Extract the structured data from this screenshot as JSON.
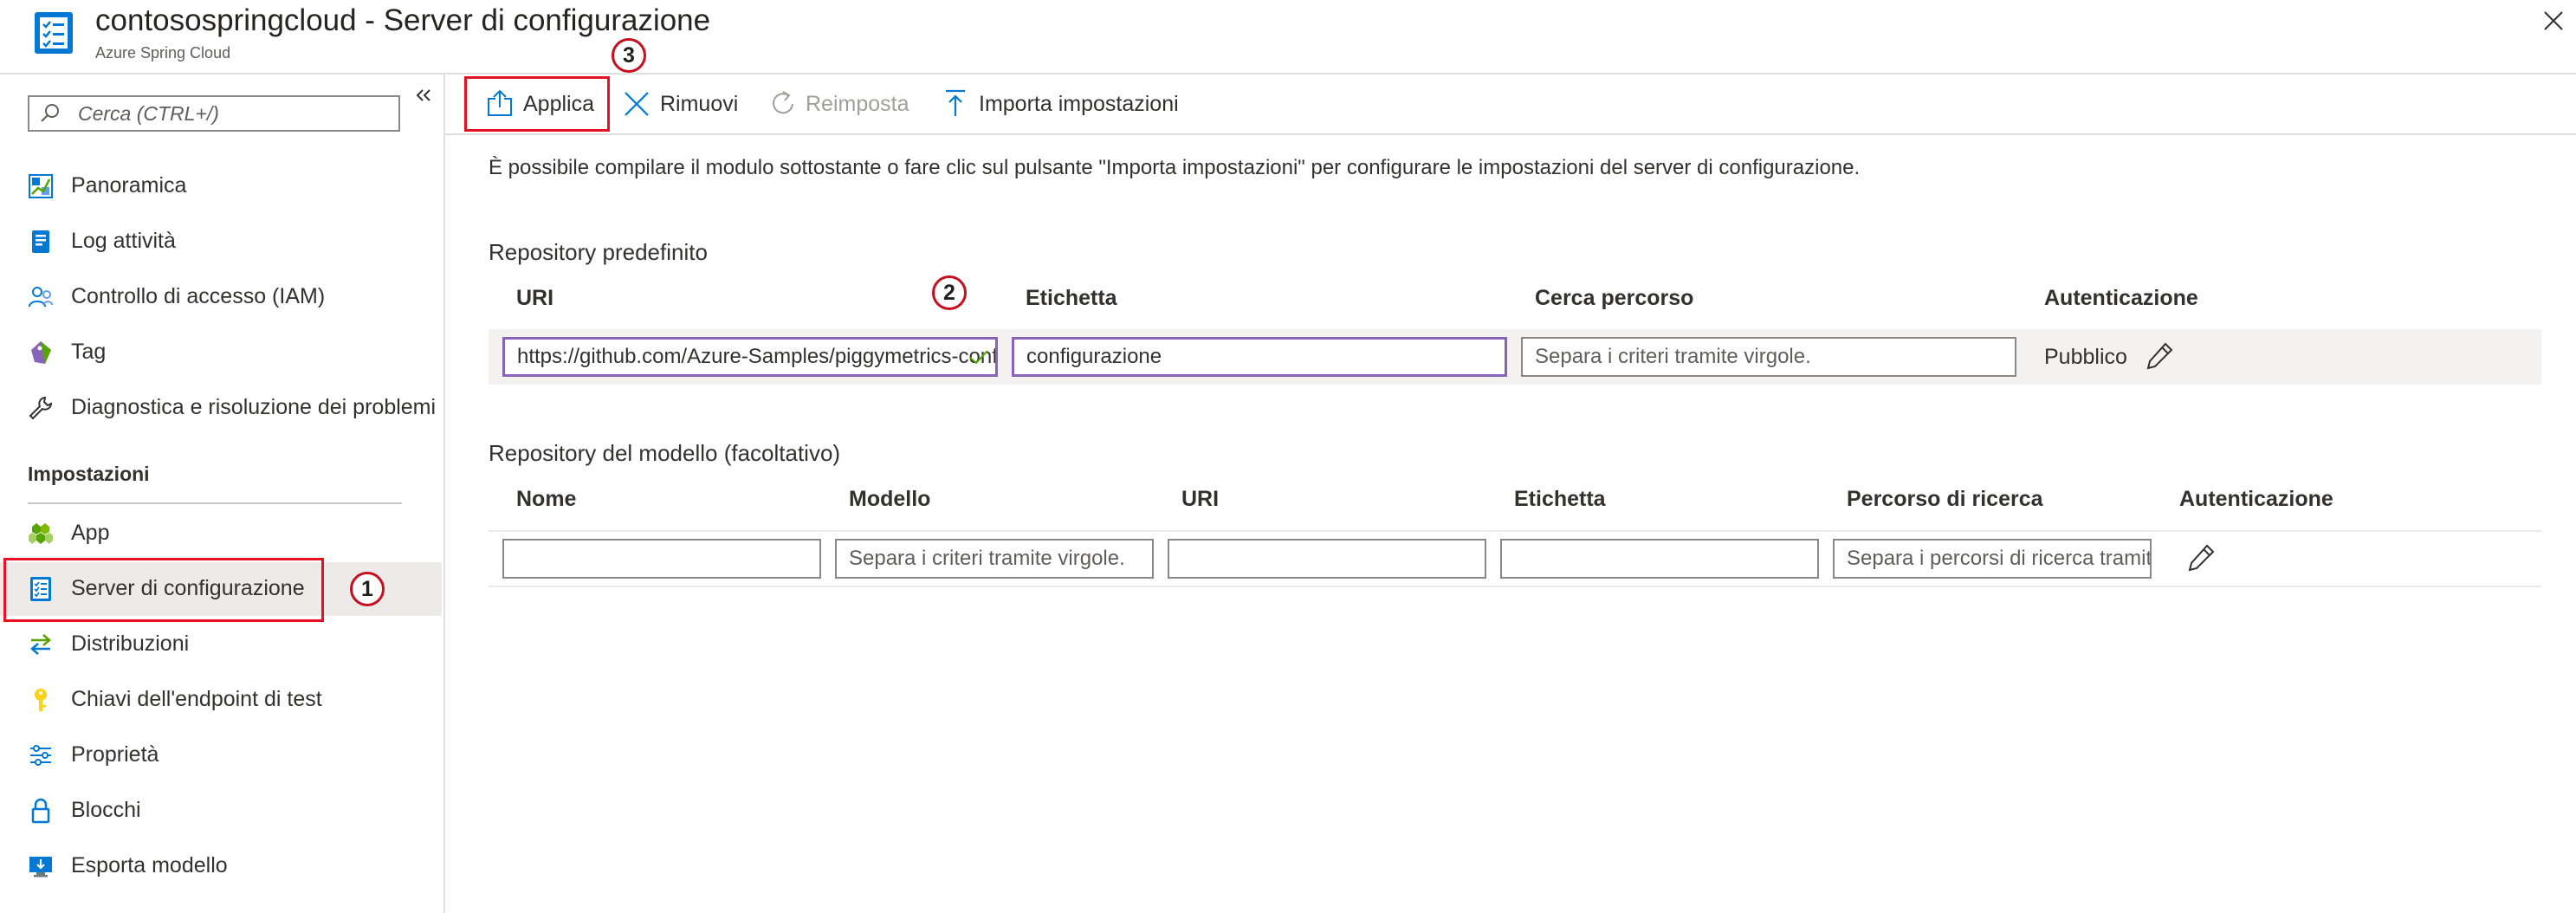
{
  "header": {
    "title": "contosospringcloud - Server di configurazione",
    "subtitle": "Azure Spring Cloud",
    "resource_icon": "config-server-icon",
    "close_icon": "close-icon"
  },
  "sidebar": {
    "search_placeholder": "Cerca (CTRL+/)",
    "collapse_icon": "double-chevron-left-icon",
    "top_items": [
      {
        "label": "Panoramica",
        "icon": "overview-icon"
      },
      {
        "label": "Log attività",
        "icon": "activity-log-icon"
      },
      {
        "label": "Controllo di accesso (IAM)",
        "icon": "iam-icon"
      },
      {
        "label": "Tag",
        "icon": "tag-icon"
      },
      {
        "label": "Diagnostica e risoluzione dei problemi",
        "icon": "wrench-icon"
      }
    ],
    "section_title": "Impostazioni",
    "settings_items": [
      {
        "label": "App",
        "icon": "apps-icon"
      },
      {
        "label": "Server di configurazione",
        "icon": "config-server-icon",
        "selected": true
      },
      {
        "label": "Distribuzioni",
        "icon": "deployments-icon"
      },
      {
        "label": "Chiavi dell'endpoint di test",
        "icon": "key-icon"
      },
      {
        "label": "Proprietà",
        "icon": "properties-icon"
      },
      {
        "label": "Blocchi",
        "icon": "lock-icon"
      },
      {
        "label": "Esporta modello",
        "icon": "export-template-icon"
      }
    ]
  },
  "callouts": {
    "one": "1",
    "two": "2",
    "three": "3"
  },
  "toolbar": {
    "apply": "Applica",
    "remove": "Rimuovi",
    "reset": "Reimposta",
    "import": "Importa impostazioni"
  },
  "main": {
    "intro": "È possibile compilare il modulo sottostante o fare clic sul pulsante \"Importa impostazioni\" per configurare le impostazioni del server di configurazione.",
    "default_repo": {
      "heading": "Repository predefinito",
      "columns": [
        "URI",
        "Etichetta",
        "Cerca percorso",
        "Autenticazione"
      ],
      "uri_value": "https://github.com/Azure-Samples/piggymetrics-config",
      "label_value": "configurazione",
      "search_path_placeholder": "Separa i criteri tramite virgole.",
      "auth_value": "Pubblico"
    },
    "pattern_repo": {
      "heading": "Repository del modello (facoltativo)",
      "columns": [
        "Nome",
        "Modello",
        "URI",
        "Etichetta",
        "Percorso di ricerca",
        "Autenticazione"
      ],
      "name_value": "",
      "pattern_placeholder": "Separa i criteri tramite virgole.",
      "uri_value": "",
      "label_value": "",
      "search_path_placeholder": "Separa i percorsi di ricerca tramite virgole."
    }
  },
  "colors": {
    "accent_blue": "#0078d4",
    "highlight_red": "#e81123",
    "active_input": "#8764b8",
    "success_green": "#107c10"
  }
}
